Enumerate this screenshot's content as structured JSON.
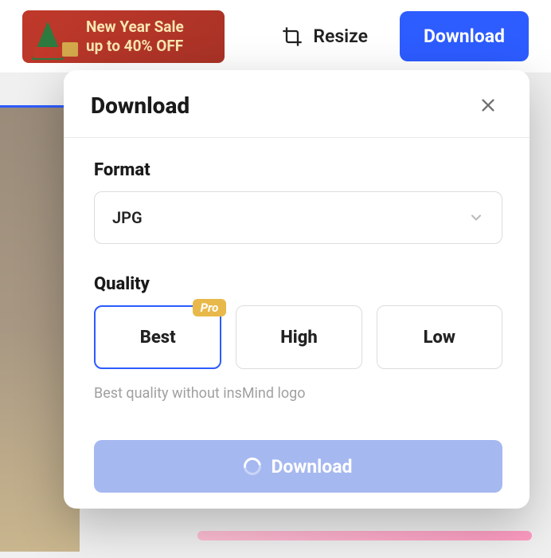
{
  "promo": {
    "line1": "New Year Sale",
    "line2": "up to 40% OFF"
  },
  "topbar": {
    "resize_label": "Resize",
    "download_label": "Download"
  },
  "modal": {
    "title": "Download",
    "format": {
      "label": "Format",
      "value": "JPG"
    },
    "quality": {
      "label": "Quality",
      "options": {
        "best": "Best",
        "high": "High",
        "low": "Low"
      },
      "pro_badge": "Pro",
      "hint": "Best quality without insMind logo"
    },
    "download_button": "Download"
  }
}
